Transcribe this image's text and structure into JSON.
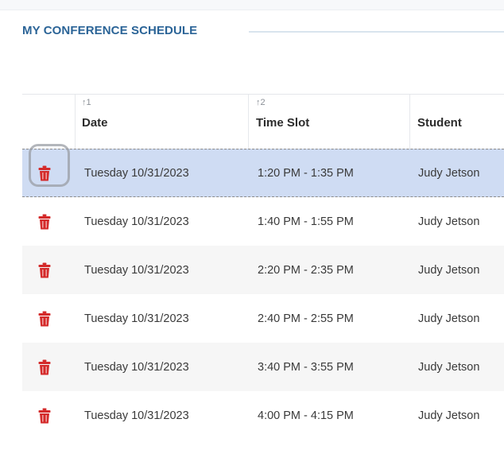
{
  "section": {
    "title": "MY CONFERENCE SCHEDULE"
  },
  "colors": {
    "accent": "#2b6497",
    "delete_icon": "#d42a2a",
    "selected_row": "#cfdcf3"
  },
  "table": {
    "columns": [
      {
        "label": "",
        "sort": ""
      },
      {
        "label": "Date",
        "sort": "↑1"
      },
      {
        "label": "Time Slot",
        "sort": "↑2"
      },
      {
        "label": "Student",
        "sort": ""
      }
    ],
    "selected_row_index": 0,
    "rows": [
      {
        "icon": "trash-icon",
        "date": "Tuesday 10/31/2023",
        "time": "1:20 PM - 1:35 PM",
        "student": "Judy Jetson"
      },
      {
        "icon": "trash-icon",
        "date": "Tuesday 10/31/2023",
        "time": "1:40 PM - 1:55 PM",
        "student": "Judy Jetson"
      },
      {
        "icon": "trash-icon",
        "date": "Tuesday 10/31/2023",
        "time": "2:20 PM - 2:35 PM",
        "student": "Judy Jetson"
      },
      {
        "icon": "trash-icon",
        "date": "Tuesday 10/31/2023",
        "time": "2:40 PM - 2:55 PM",
        "student": "Judy Jetson"
      },
      {
        "icon": "trash-icon",
        "date": "Tuesday 10/31/2023",
        "time": "3:40 PM - 3:55 PM",
        "student": "Judy Jetson"
      },
      {
        "icon": "trash-icon",
        "date": "Tuesday 10/31/2023",
        "time": "4:00 PM - 4:15 PM",
        "student": "Judy Jetson"
      }
    ]
  }
}
